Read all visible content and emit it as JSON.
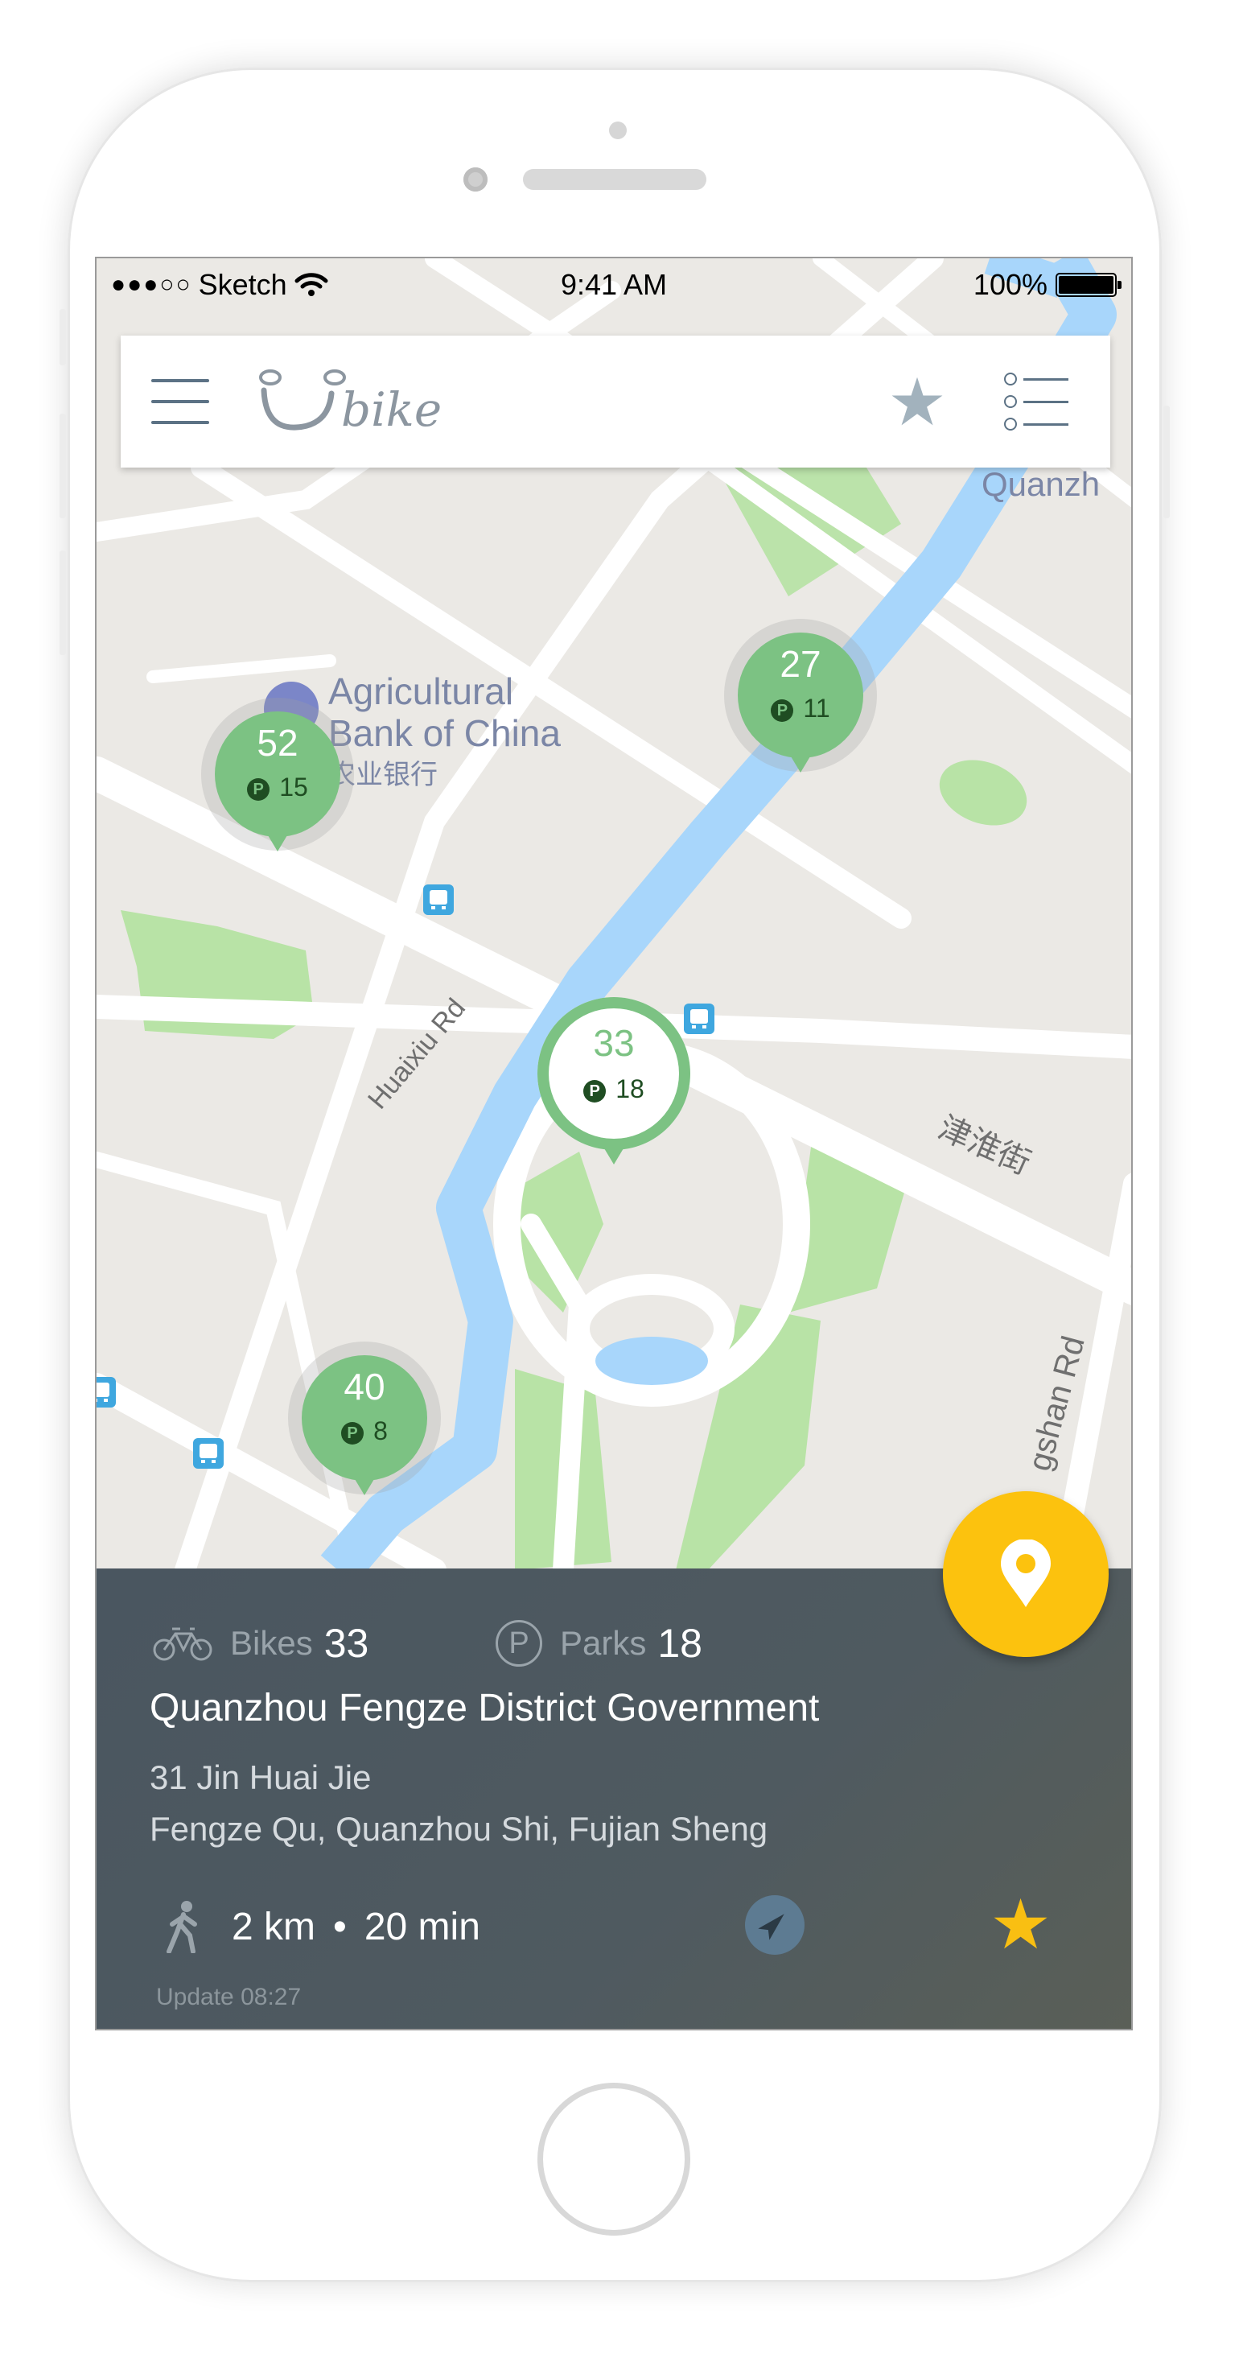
{
  "status_bar": {
    "carrier": "Sketch",
    "signal_dots": "●●●○○",
    "time": "9:41 AM",
    "battery": "100%"
  },
  "header": {
    "logo_text": "bike",
    "menu_icon": "hamburger-icon",
    "favorite_icon": "star-icon",
    "list_icon": "list-icon"
  },
  "map": {
    "labels": {
      "poi_en": "Agricultural Bank of China",
      "poi_zh": "农业银行",
      "district": "Quanzh",
      "road_huaixiu": "Huaixiu Rd",
      "road_jinhuai": "津淮街",
      "road_shan": "gshan Rd"
    },
    "stations": [
      {
        "bikes": "52",
        "parks": "15"
      },
      {
        "bikes": "27",
        "parks": "11"
      },
      {
        "bikes": "33",
        "parks": "18",
        "selected": true
      },
      {
        "bikes": "40",
        "parks": "8"
      }
    ]
  },
  "panel": {
    "bikes_label": "Bikes",
    "bikes_value": "33",
    "parks_label": "Parks",
    "parks_value": "18",
    "station_name": "Quanzhou Fengze District Government",
    "address_line1": "31 Jin Huai Jie",
    "address_line2": "Fengze Qu, Quanzhou Shi, Fujian Sheng",
    "distance": "2 km",
    "separator": "•",
    "duration": "20 min",
    "update_text": "Update 08:27"
  },
  "colors": {
    "station_green": "#7cc283",
    "panel_bg": "#4a5660",
    "fab_yellow": "#fcc20e",
    "water": "#a8d6fb",
    "park": "#b8e3a6"
  }
}
